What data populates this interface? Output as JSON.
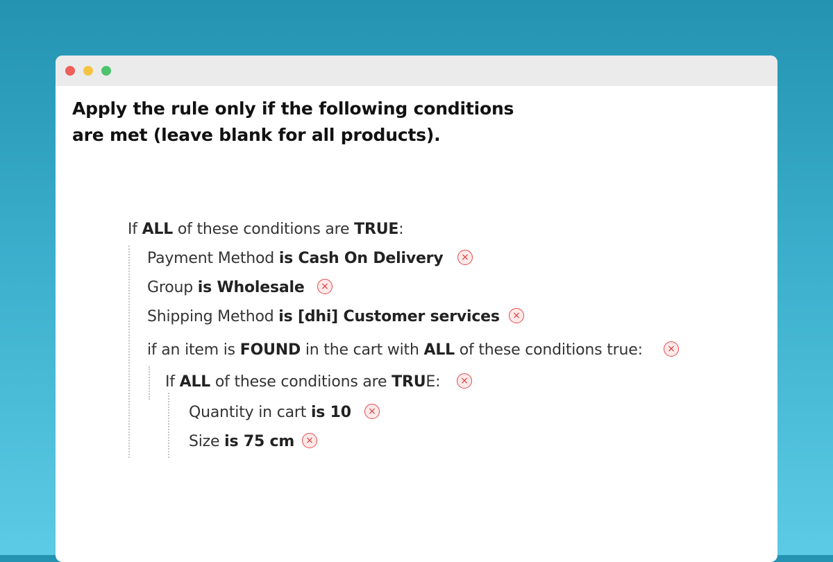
{
  "window": {
    "controls": [
      "close",
      "minimize",
      "maximize"
    ]
  },
  "heading": {
    "line1": "Apply the rule only if the following conditions",
    "line2": "are met (leave blank for all products)."
  },
  "root": {
    "prefix": "If",
    "aggregator": "ALL",
    "middle": "of these conditions are",
    "value": "TRUE",
    "suffix": ":"
  },
  "conditions": [
    {
      "attribute": "Payment Method",
      "operator_value": "is Cash On Delivery"
    },
    {
      "attribute": "Group",
      "operator_value": "is Wholesale"
    },
    {
      "attribute": "Shipping Method",
      "operator_value": "is [dhi] Customer services"
    }
  ],
  "product_found": {
    "part1": "if an item is",
    "found": "FOUND",
    "part2": "in the cart with",
    "aggregator": "ALL",
    "part3": "of these conditions true:"
  },
  "nested": {
    "prefix": "If",
    "aggregator": "ALL",
    "middle": "of these conditions are",
    "value_bold": "TRU",
    "value_rest": "E:",
    "conditions": [
      {
        "attribute": "Quantity in cart",
        "operator_value": "is 10"
      },
      {
        "attribute": "Size",
        "operator_value": "is 75 cm"
      }
    ]
  },
  "remove_icon_glyph": "×",
  "colors": {
    "background_top": "#2393b1",
    "background_bottom": "#5ccbe5",
    "remove_icon": "#e24a4a",
    "remove_icon_fill": "#fde9e9"
  }
}
